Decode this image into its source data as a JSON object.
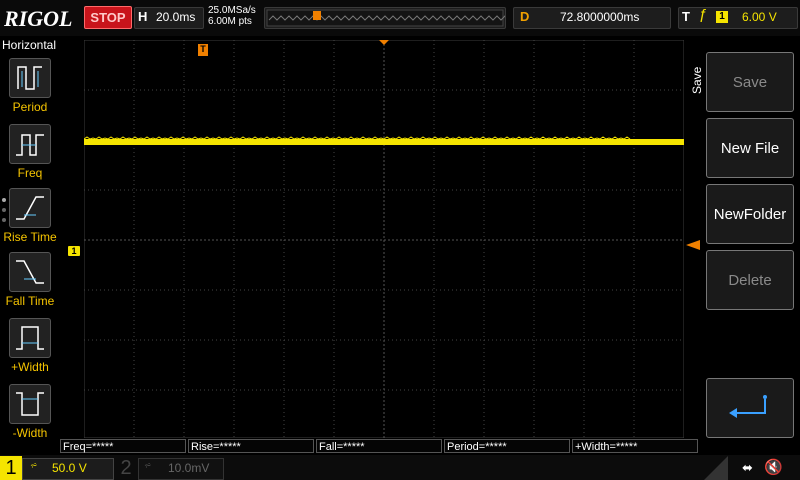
{
  "header": {
    "logo": "RIGOL",
    "run_state": "STOP",
    "h_letter": "H",
    "h_scale": "20.0ms",
    "sample_rate": "25.0MSa/s",
    "memory_depth": "6.00M pts",
    "d_letter": "D",
    "delay": "72.8000000ms",
    "t_letter": "T",
    "trigger_source": "1",
    "trigger_level": "6.00 V",
    "trigger_marker": "T"
  },
  "left_menu": {
    "title": "Horizontal",
    "items": [
      {
        "label": "Period",
        "icon": "period-icon"
      },
      {
        "label": "Freq",
        "icon": "freq-icon"
      },
      {
        "label": "Rise Time",
        "icon": "rise-time-icon"
      },
      {
        "label": "Fall Time",
        "icon": "fall-time-icon"
      },
      {
        "label": "+Width",
        "icon": "pos-width-icon"
      },
      {
        "label": "-Width",
        "icon": "neg-width-icon"
      }
    ]
  },
  "right_menu": {
    "title": "Save",
    "buttons": [
      {
        "label": "Save",
        "enabled": false
      },
      {
        "label": "New File",
        "enabled": true
      },
      {
        "label": "NewFolder",
        "enabled": true
      },
      {
        "label": "Delete",
        "enabled": false
      }
    ],
    "back_icon": "enter-arrow-icon"
  },
  "channel_marker": "1",
  "measurements": [
    "Freq=*****",
    "Rise=*****",
    "Fall=*****",
    "Period=*****",
    "+Width=*****"
  ],
  "status": {
    "ch1_number": "1",
    "ch1_scale": "50.0 V",
    "ch2_number": "2",
    "ch2_scale": "10.0mV",
    "ch1_color": "#f5e400"
  }
}
